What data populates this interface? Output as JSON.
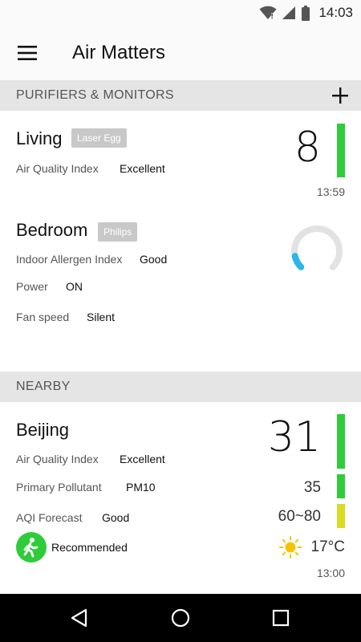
{
  "status_bar": {
    "time": "14:03",
    "icons": [
      "wifi-icon",
      "signal-icon",
      "battery-icon"
    ]
  },
  "app_bar": {
    "title": "Air Matters",
    "menu_icon": "hamburger-menu-icon"
  },
  "purifiers_section": {
    "title": "PURIFIERS & MONITORS",
    "add_icon": "plus-icon",
    "devices": [
      {
        "name": "Living",
        "tag": "Laser Egg",
        "rows": [
          {
            "label": "Air Quality Index",
            "value": "Excellent"
          }
        ],
        "aqi": "8",
        "updated": "13:59",
        "bar_color": "#2fcc3a"
      },
      {
        "name": "Bedroom",
        "tag": "Philips",
        "rows": [
          {
            "label": "Indoor Allergen Index",
            "value": "Good"
          },
          {
            "label": "Power",
            "value": "ON"
          },
          {
            "label": "Fan speed",
            "value": "Silent"
          }
        ],
        "gauge_fraction": 0.12,
        "gauge_color": "#29b6e8",
        "gauge_track_color": "#e2e2e2"
      }
    ]
  },
  "nearby_section": {
    "title": "NEARBY",
    "city": {
      "name": "Beijing",
      "rows": [
        {
          "label": "Air Quality Index",
          "value": "Excellent"
        },
        {
          "label": "Primary Pollutant",
          "value": "PM10"
        },
        {
          "label": "AQI Forecast",
          "value": "Good"
        }
      ],
      "aqi": "31",
      "pollutant_value": "35",
      "forecast_range": "60~80",
      "recommendation": "Recommended",
      "temperature": "17°C",
      "updated": "13:00",
      "aqi_bar_color": "#2fcc3a",
      "pollutant_bar_color": "#2fcc3a",
      "forecast_bar_color": "#d8dc22",
      "recommend_color": "#2fcc3a",
      "weather_icon": "sun-icon",
      "weather_color": "#f5c400"
    }
  },
  "nav_bar": {
    "icons": [
      "back-icon",
      "home-icon",
      "recents-icon"
    ]
  }
}
